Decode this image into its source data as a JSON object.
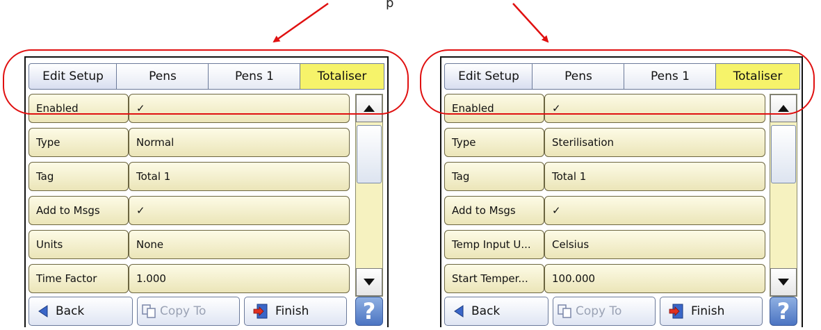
{
  "top_text": "p",
  "colors": {
    "annotation": "#e01010",
    "active_crumb": "#f6f36a",
    "check": "#1c8a1c"
  },
  "left": {
    "breadcrumb": [
      "Edit Setup",
      "Pens",
      "Pens 1",
      "Totaliser"
    ],
    "rows": [
      {
        "label": "Enabled",
        "value": "✓"
      },
      {
        "label": "Type",
        "value": "Normal"
      },
      {
        "label": "Tag",
        "value": "Total 1"
      },
      {
        "label": "Add to Msgs",
        "value": "✓"
      },
      {
        "label": "Units",
        "value": "None"
      },
      {
        "label": "Time Factor",
        "value": "1.000"
      }
    ],
    "buttons": {
      "back": "Back",
      "copy_to": "Copy To",
      "finish": "Finish",
      "help": "?"
    }
  },
  "right": {
    "breadcrumb": [
      "Edit Setup",
      "Pens",
      "Pens 1",
      "Totaliser"
    ],
    "rows": [
      {
        "label": "Enabled",
        "value": "✓"
      },
      {
        "label": "Type",
        "value": "Sterilisation"
      },
      {
        "label": "Tag",
        "value": "Total 1"
      },
      {
        "label": "Add to Msgs",
        "value": "✓"
      },
      {
        "label": "Temp Input U...",
        "value": "Celsius"
      },
      {
        "label": "Start Temper...",
        "value": "100.000"
      }
    ],
    "buttons": {
      "back": "Back",
      "copy_to": "Copy To",
      "finish": "Finish",
      "help": "?"
    }
  }
}
